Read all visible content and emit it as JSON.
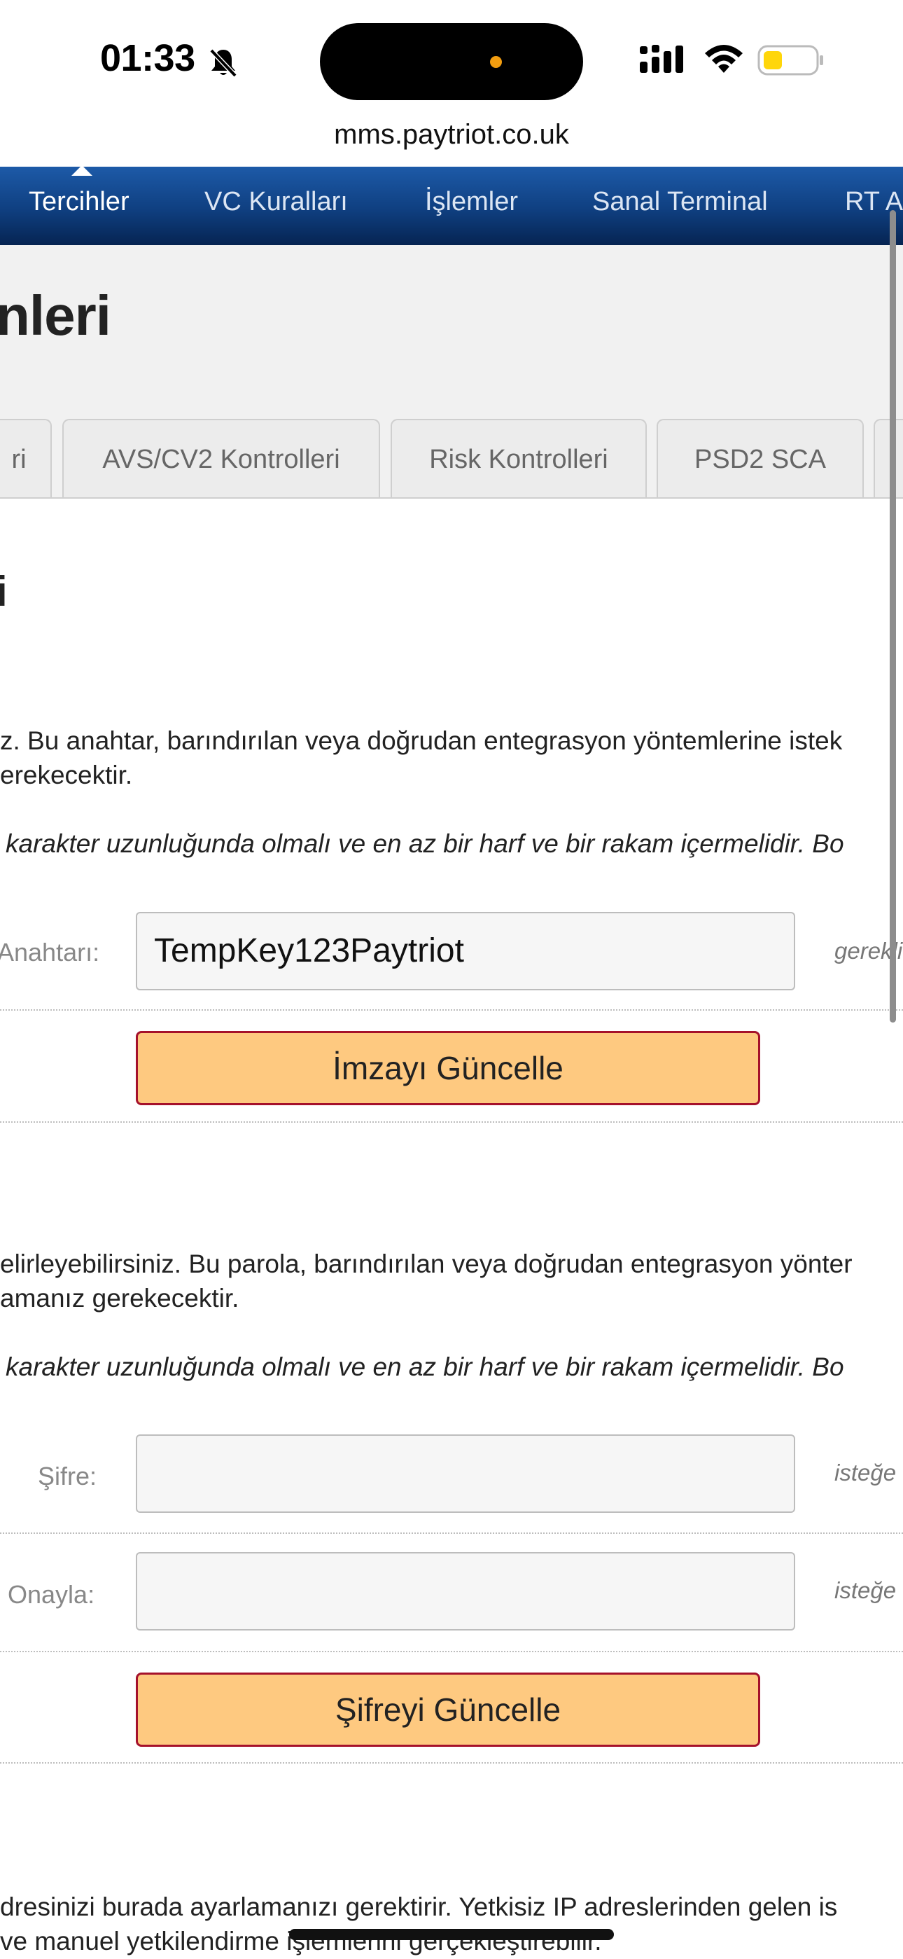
{
  "status": {
    "time": "01:33"
  },
  "browser": {
    "url": "mms.paytriot.co.uk"
  },
  "nav": {
    "items": [
      {
        "label": "Tercihler"
      },
      {
        "label": "VC Kuralları"
      },
      {
        "label": "İşlemler"
      },
      {
        "label": "Sanal Terminal"
      },
      {
        "label": "RT A"
      }
    ]
  },
  "page": {
    "title": "nleri"
  },
  "tabs": [
    {
      "label": "ri"
    },
    {
      "label": "AVS/CV2 Kontrolleri"
    },
    {
      "label": "Risk Kontrolleri"
    },
    {
      "label": "PSD2 SCA"
    }
  ],
  "signature": {
    "section_title": "i",
    "desc_line1": "z. Bu anahtar, barındırılan veya doğrudan entegrasyon yöntemlerine istek",
    "desc_line2": "erekecektir.",
    "rule": "karakter uzunluğunda olmalı ve en az bir harf ve bir rakam içermelidir. Bo",
    "key_label": "Anahtarı:",
    "key_value": "TempKey123Paytriot",
    "key_hint": "gerekli",
    "update_button": "İmzayı Güncelle"
  },
  "password": {
    "desc_line1": "elirleyebilirsiniz. Bu parola, barındırılan veya doğrudan entegrasyon yönter",
    "desc_line2": "amanız gerekecektir.",
    "rule": "karakter uzunluğunda olmalı ve en az bir harf ve bir rakam içermelidir. Bo",
    "password_label": "Şifre:",
    "password_hint": "isteğe",
    "confirm_label": "Onayla:",
    "confirm_hint": "isteğe",
    "update_button": "Şifreyi Güncelle"
  },
  "ip": {
    "desc_line1": "dresinizi burada ayarlamanızı gerektirir. Yetkisiz IP adreslerinden gelen is",
    "desc_line2": "ve manuel yetkilendirme işlemlerini gerçekleştirebilir."
  }
}
